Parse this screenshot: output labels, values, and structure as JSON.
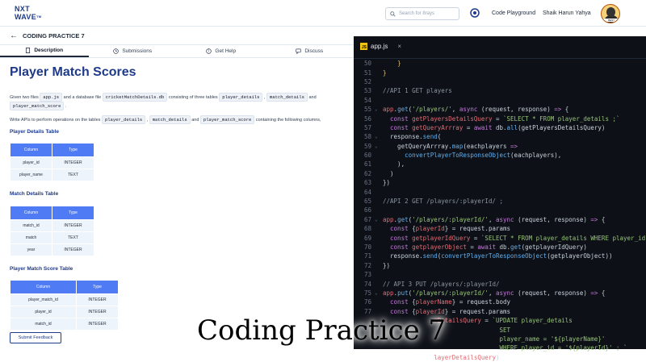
{
  "header": {
    "logo": "NXT WAVE",
    "logo_tm": "TM",
    "search_placeholder": "Search for 8rays",
    "code_playground": "Code Playground",
    "username": "Shaik Harun Yahya",
    "avatar_text": "BEST"
  },
  "breadcrumb": {
    "title": "CODING PRACTICE 7"
  },
  "tabs": [
    {
      "label": "Description",
      "icon": "document-icon"
    },
    {
      "label": "Submissions",
      "icon": "clock-icon"
    },
    {
      "label": "Get Help",
      "icon": "help-icon"
    },
    {
      "label": "Discuss",
      "icon": "chat-icon"
    }
  ],
  "problem": {
    "title": "Player Match Scores",
    "intro": {
      "t1": "Given two files",
      "c1": "app.js",
      "t2": "and a database file",
      "c2": "cricketMatchDetails.db",
      "t3": "consisting of three tables",
      "c3": "player_details",
      "t4": ",",
      "c4": "match_details",
      "t5": "and",
      "c5": "player_match_score",
      "t6": "."
    },
    "write": {
      "t1": "Write APIs to perform operations on the tables",
      "c1": "player_details",
      "t2": ",",
      "c2": "match_details",
      "t3": "and",
      "c3": "player_match_score",
      "t4": "containing the following columns,"
    },
    "tables": [
      {
        "heading": "Player Details Table",
        "columns": [
          "Column",
          "Type"
        ],
        "rows": [
          [
            "player_id",
            "INTEGER"
          ],
          [
            "player_name",
            "TEXT"
          ]
        ]
      },
      {
        "heading": "Match Details Table",
        "columns": [
          "Column",
          "Type"
        ],
        "rows": [
          [
            "match_id",
            "INTEGER"
          ],
          [
            "match",
            "TEXT"
          ],
          [
            "year",
            "INTEGER"
          ]
        ]
      },
      {
        "heading": "Player Match Score Table",
        "columns": [
          "Column",
          "Type"
        ],
        "rows": [
          [
            "player_match_id",
            "INTEGER"
          ],
          [
            "player_id",
            "INTEGER"
          ],
          [
            "match_id",
            "INTEGER"
          ]
        ]
      }
    ],
    "feedback_button": "Submit Feedback"
  },
  "editor": {
    "filename": "app.js",
    "close": "×",
    "lines": [
      {
        "n": "50",
        "fold": "",
        "html": "    <span class='y'>}</span>"
      },
      {
        "n": "51",
        "fold": "",
        "html": "<span class='y'>}</span>"
      },
      {
        "n": "52",
        "fold": "",
        "html": ""
      },
      {
        "n": "53",
        "fold": "",
        "html": "<span class='c'>//API 1 GET players</span>"
      },
      {
        "n": "54",
        "fold": "",
        "html": ""
      },
      {
        "n": "55",
        "fold": "⌄",
        "html": "<span class='v'>app</span>.<span class='f'>get</span>(<span class='s'>'/players/'</span>, <span class='k'>async</span> (request, response) <span class='k'>=></span> {"
      },
      {
        "n": "56",
        "fold": "",
        "html": "  <span class='k'>const</span> <span class='v'>getPlayersDetailsQuery</span> = <span class='s'>`SELECT * FROM player_details ;`</span>"
      },
      {
        "n": "57",
        "fold": "",
        "html": "  <span class='k'>const</span> <span class='v'>getQueryArrray</span> = <span class='k'>await</span> db.<span class='f'>all</span>(getPlayersDetailsQuery)"
      },
      {
        "n": "58",
        "fold": "⌄",
        "html": "  response.<span class='f'>send</span>("
      },
      {
        "n": "59",
        "fold": "⌄",
        "html": "    getQueryArrray.<span class='f'>map</span>(eachplayers <span class='k'>=></span>"
      },
      {
        "n": "60",
        "fold": "",
        "html": "      <span class='f'>convertPlayerToResponseObject</span>(eachplayers),"
      },
      {
        "n": "61",
        "fold": "",
        "html": "    ),"
      },
      {
        "n": "62",
        "fold": "",
        "html": "  )"
      },
      {
        "n": "63",
        "fold": "",
        "html": "})"
      },
      {
        "n": "64",
        "fold": "",
        "html": ""
      },
      {
        "n": "65",
        "fold": "",
        "html": "<span class='c'>//API 2 GET /players/:playerId/ ;</span>"
      },
      {
        "n": "66",
        "fold": "",
        "html": ""
      },
      {
        "n": "67",
        "fold": "⌄",
        "html": "<span class='v'>app</span>.<span class='f'>get</span>(<span class='s'>'/players/:playerId/'</span>, <span class='k'>async</span> (request, response) <span class='k'>=></span> {"
      },
      {
        "n": "68",
        "fold": "",
        "html": "  <span class='k'>const</span> {<span class='v'>playerId</span>} = request.params"
      },
      {
        "n": "69",
        "fold": "",
        "html": "  <span class='k'>const</span> <span class='v'>getplayerIdQuery</span> = <span class='s'>`SELECT * FROM player_details WHERE player_id</span>"
      },
      {
        "n": "70",
        "fold": "",
        "html": "  <span class='k'>const</span> <span class='v'>getplayerObject</span> = <span class='k'>await</span> db.<span class='f'>get</span>(getplayerIdQuery)"
      },
      {
        "n": "71",
        "fold": "",
        "html": "  response.<span class='f'>send</span>(<span class='f'>convertPlayerToResponseObject</span>(getplayerObject))"
      },
      {
        "n": "72",
        "fold": "",
        "html": "})"
      },
      {
        "n": "73",
        "fold": "",
        "html": ""
      },
      {
        "n": "74",
        "fold": "",
        "html": "<span class='c'>// API 3 PUT /players/:playerId/</span>"
      },
      {
        "n": "75",
        "fold": "⌄",
        "html": "<span class='v'>app</span>.<span class='f'>put</span>(<span class='s'>'/players/:playerId/'</span>, <span class='k'>async</span> (request, response) <span class='k'>=></span> {"
      },
      {
        "n": "76",
        "fold": "",
        "html": "  <span class='k'>const</span> {<span class='v'>playerName</span>} = request.body"
      },
      {
        "n": "77",
        "fold": "",
        "html": "  <span class='k'>const</span> {<span class='v'>playerId</span>} = request.params"
      },
      {
        "n": "",
        "fold": "",
        "html": "              <span class='v'>rDetailsQuery</span> = <span class='s'>`UPDATE player_details</span>"
      },
      {
        "n": "",
        "fold": "",
        "html": "                                <span class='s'>SET</span>"
      },
      {
        "n": "",
        "fold": "",
        "html": "                                <span class='s'>player_name = '${playerName}'</span>"
      },
      {
        "n": "",
        "fold": "",
        "html": "                                <span class='s'>WHERE player_id = '${playerId}' ; `</span>"
      },
      {
        "n": "",
        "fold": "",
        "html": "              <span class='v'>layerDetailsQuery</span>)"
      }
    ]
  },
  "overlay_caption": "Coding Practice 7"
}
